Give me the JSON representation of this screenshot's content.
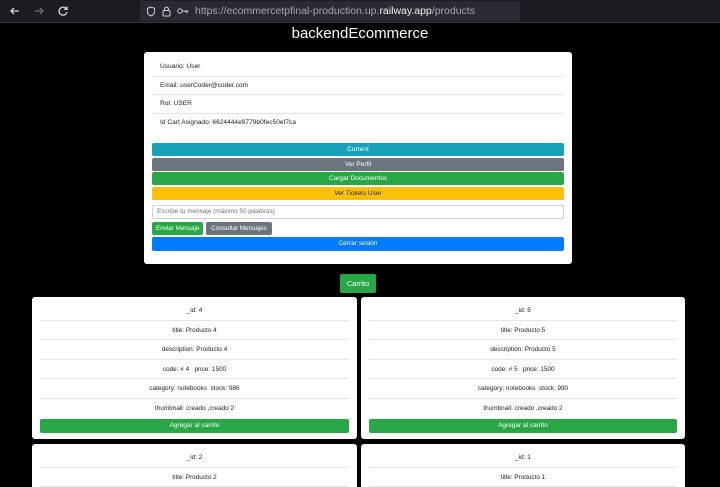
{
  "browser": {
    "url_prefix": "https://ecommercetpfinal-production.up.",
    "url_host": "railway.app",
    "url_path": "/products"
  },
  "page": {
    "title": "backendEcommerce"
  },
  "user": {
    "usuario": "Usuario: User",
    "email": "Email: userCoder@coder.com",
    "rol": "Rol: USER",
    "cart_id": "Id Cart Asignado: 6624444e9779b0fec50ef7ca"
  },
  "actions": {
    "current": "Current",
    "ver_perfil": "Ver Perfil",
    "cargar_documentos": "Cargar Documentos",
    "ver_tickets": "Ver Tickets User",
    "message_placeholder": "Escribe tu mensaje (máximo 50 palabras)",
    "enviar": "Enviar Mensaje",
    "consultar": "Consultar Mensajes",
    "logout": "Cerrar sesión",
    "carrito": "Carrito"
  },
  "products": [
    {
      "id": "_id: 4",
      "title": "title: Producto 4",
      "description": "description: Producto 4",
      "code_price": "code: # 4   price: 1500",
      "category_stock": "category: notebooks  stock: 986",
      "thumbnail": "thumbnail: creado ,creado 2",
      "add": "Agregar al carrito"
    },
    {
      "id": "_id: 5",
      "title": "title: Producto 5",
      "description": "description: Producto 5",
      "code_price": "code: # 5   price: 1500",
      "category_stock": "category: notebooks  stock: 990",
      "thumbnail": "thumbnail: creado ,creado 2",
      "add": "Agregar al carrito"
    },
    {
      "id": "_id: 2",
      "title": "title: Producto 2"
    },
    {
      "id": "_id: 1",
      "title": "title: Producto 1"
    }
  ],
  "icons": {
    "back": "arrow-left-icon",
    "forward": "arrow-right-icon",
    "reload": "reload-icon",
    "shield": "shield-icon",
    "lock": "lock-icon",
    "key": "key-icon"
  }
}
